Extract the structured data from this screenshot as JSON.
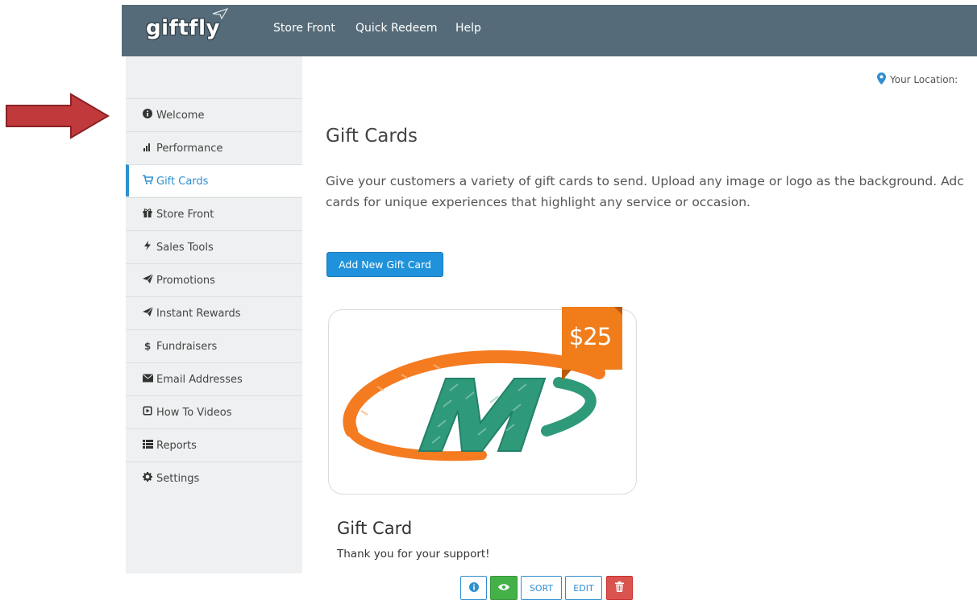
{
  "header": {
    "logo": "giftfly",
    "nav": [
      "Store Front",
      "Quick Redeem",
      "Help"
    ]
  },
  "sidebar": {
    "items": [
      {
        "label": "Welcome",
        "icon": "info-icon"
      },
      {
        "label": "Performance",
        "icon": "bar-chart-icon"
      },
      {
        "label": "Gift Cards",
        "icon": "cart-icon",
        "active": true
      },
      {
        "label": "Store Front",
        "icon": "gift-icon"
      },
      {
        "label": "Sales Tools",
        "icon": "bolt-icon"
      },
      {
        "label": "Promotions",
        "icon": "paper-plane-icon"
      },
      {
        "label": "Instant Rewards",
        "icon": "paper-plane-icon"
      },
      {
        "label": "Fundraisers",
        "icon": "dollar-icon"
      },
      {
        "label": "Email Addresses",
        "icon": "envelope-icon"
      },
      {
        "label": "How To Videos",
        "icon": "play-icon"
      },
      {
        "label": "Reports",
        "icon": "list-icon"
      },
      {
        "label": "Settings",
        "icon": "gear-icon"
      }
    ]
  },
  "main": {
    "location_label": "Your Location:",
    "title": "Gift Cards",
    "description_line1": "Give your customers a variety of gift cards to send. Upload any image or logo as the background. Adc",
    "description_line2": "cards for unique experiences that highlight any service or occasion.",
    "add_button": "Add New Gift Card"
  },
  "card": {
    "price": "$25",
    "title": "Gift Card",
    "subtitle": "Thank you for your support!",
    "buttons": {
      "sort": "SORT",
      "edit": "EDIT"
    }
  },
  "colors": {
    "header_bg": "#566b79",
    "accent": "#2f8fd1",
    "price_tag": "#f07d1a",
    "logo_orange": "#f47b20",
    "logo_green": "#2e9a7a",
    "view_button": "#43b048",
    "delete_button": "#d9534f",
    "arrow": "#c0393b"
  }
}
